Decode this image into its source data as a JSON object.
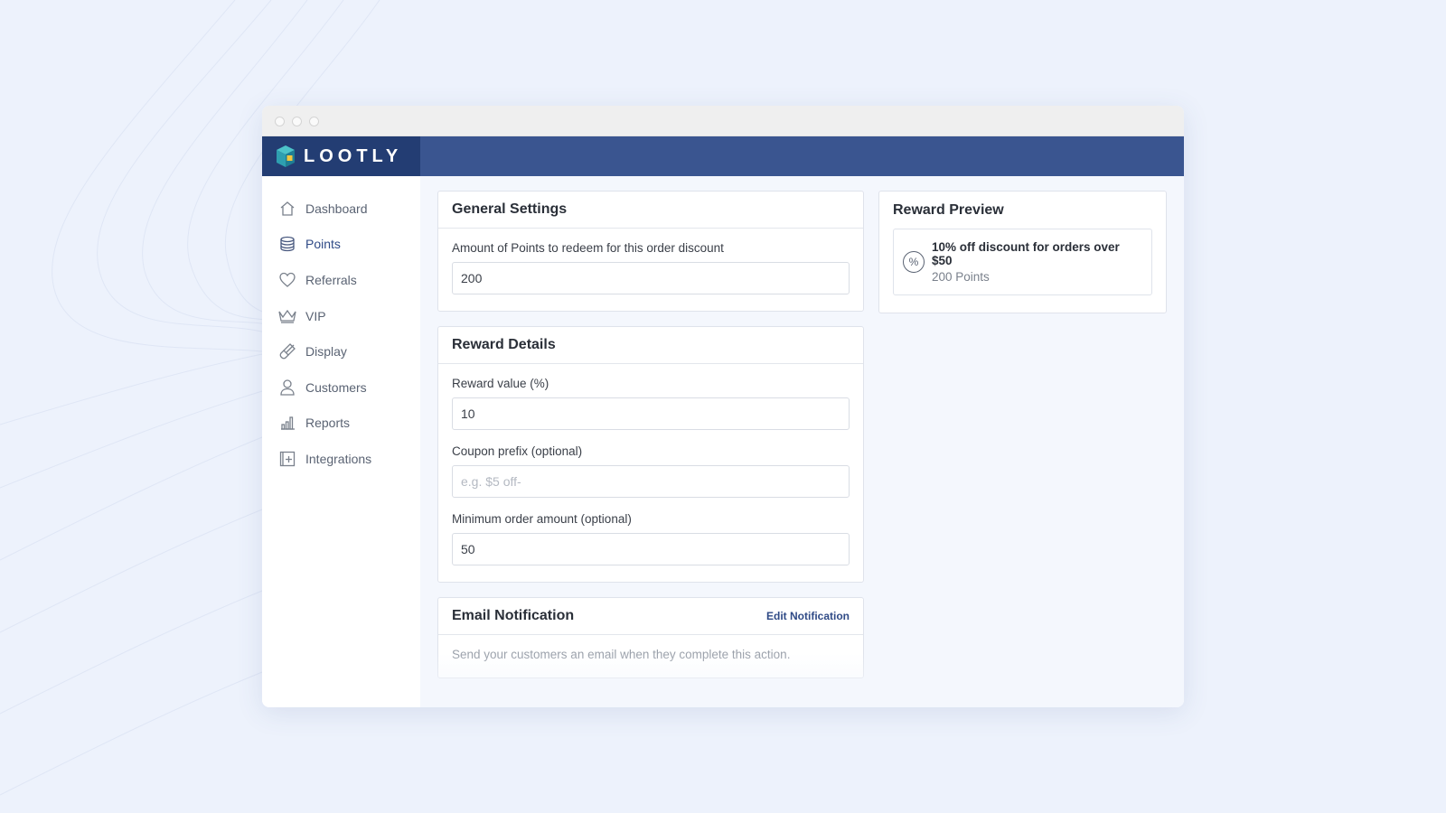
{
  "app": {
    "brand": "LOOTLY"
  },
  "sidebar": {
    "items": [
      {
        "label": "Dashboard",
        "icon": "home-icon",
        "active": false
      },
      {
        "label": "Points",
        "icon": "coins-icon",
        "active": true
      },
      {
        "label": "Referrals",
        "icon": "heart-icon",
        "active": false
      },
      {
        "label": "VIP",
        "icon": "crown-icon",
        "active": false
      },
      {
        "label": "Display",
        "icon": "brush-icon",
        "active": false
      },
      {
        "label": "Customers",
        "icon": "user-icon",
        "active": false
      },
      {
        "label": "Reports",
        "icon": "bar-chart-icon",
        "active": false
      },
      {
        "label": "Integrations",
        "icon": "plus-square-icon",
        "active": false
      }
    ]
  },
  "general": {
    "title": "General Settings",
    "points_label": "Amount of Points to redeem for this order discount",
    "points_value": "200"
  },
  "reward": {
    "title": "Reward Details",
    "value_label": "Reward value (%)",
    "value": "10",
    "prefix_label": "Coupon prefix (optional)",
    "prefix_placeholder": "e.g. $5 off-",
    "min_label": "Minimum order amount (optional)",
    "min_value": "50"
  },
  "email": {
    "title": "Email Notification",
    "edit_link": "Edit Notification",
    "description": "Send your customers an email when they complete this action."
  },
  "preview": {
    "title": "Reward Preview",
    "reward_title": "10% off discount for orders over $50",
    "reward_points": "200 Points",
    "icon": "percent-icon"
  },
  "colors": {
    "brand_dark": "#233d73",
    "topbar": "#3a5590",
    "accent": "#2f4a86",
    "background": "#edf2fc"
  }
}
